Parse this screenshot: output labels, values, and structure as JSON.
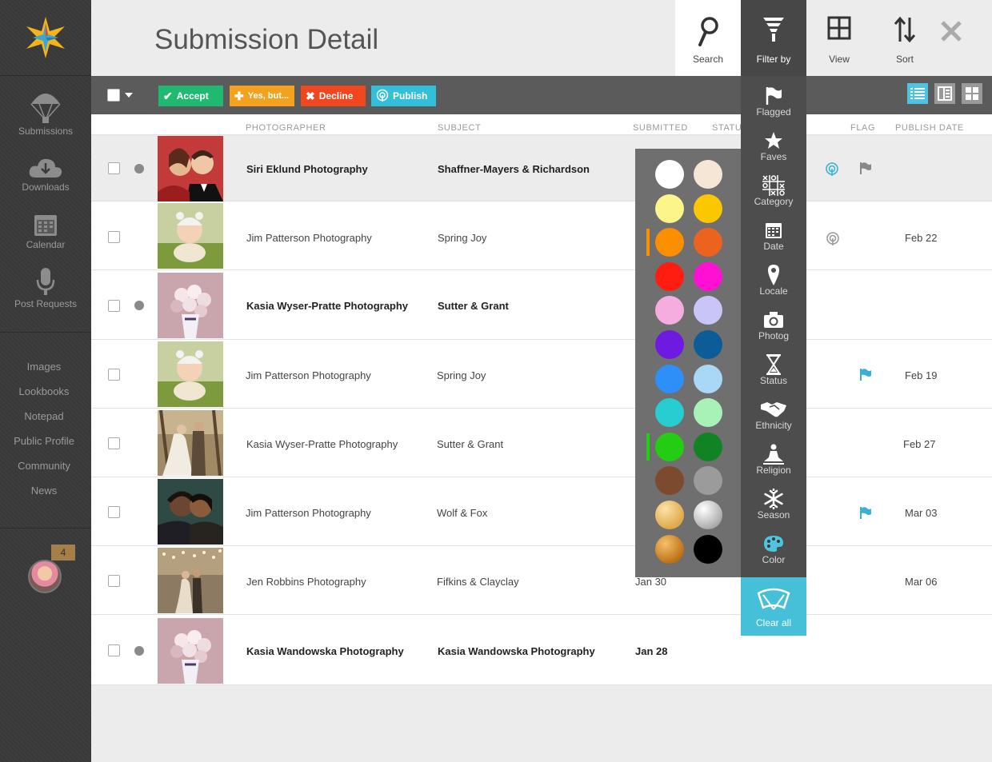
{
  "header": {
    "title": "Submission Detail"
  },
  "tools": {
    "search": "Search",
    "filter": "Filter by",
    "view": "View",
    "sort": "Sort"
  },
  "nav": {
    "main": [
      {
        "label": "Submissions",
        "icon": "parachute-icon"
      },
      {
        "label": "Downloads",
        "icon": "cloud-download-icon"
      },
      {
        "label": "Calendar",
        "icon": "calendar-icon"
      },
      {
        "label": "Post Requests",
        "icon": "microphone-icon"
      }
    ],
    "secondary": [
      "Images",
      "Lookbooks",
      "Notepad",
      "Public Profile",
      "Community",
      "News"
    ],
    "notifications": "4"
  },
  "toolbar": {
    "accept": "Accept",
    "yes_but": "Yes, but...",
    "decline": "Decline",
    "publish": "Publish"
  },
  "columns": {
    "photographer": "PHOTOGRAPHER",
    "subject": "SUBJECT",
    "submitted": "SUBMITTED",
    "status": "STATU",
    "flag": "FLAG",
    "publish_date": "PUBLISH DATE"
  },
  "rows": [
    {
      "photographer": "Siri Eklund Photography",
      "subject": "Shaffner-Mayers & Richardson",
      "submitted": "",
      "publish_date": "",
      "unread": true,
      "published": true,
      "flagged": true,
      "selected": true
    },
    {
      "photographer": "Jim Patterson Photography",
      "subject": "Spring Joy",
      "submitted": "",
      "publish_date": "Feb 22",
      "unread": false,
      "published": true,
      "flagged": false,
      "selected": false
    },
    {
      "photographer": "Kasia Wyser-Pratte Photography",
      "subject": "Sutter & Grant",
      "submitted": "",
      "publish_date": "",
      "unread": true,
      "published": false,
      "flagged": false,
      "selected": false
    },
    {
      "photographer": "Jim Patterson Photography",
      "subject": "Spring Joy",
      "submitted": "",
      "publish_date": "Feb 19",
      "unread": false,
      "published": false,
      "flagged": true,
      "selected": false
    },
    {
      "photographer": "Kasia Wyser-Pratte Photography",
      "subject": "Sutter & Grant",
      "submitted": "",
      "publish_date": "Feb 27",
      "unread": false,
      "published": false,
      "flagged": false,
      "selected": false
    },
    {
      "photographer": "Jim Patterson Photography",
      "subject": "Wolf & Fox",
      "submitted": "",
      "publish_date": "Mar 03",
      "unread": false,
      "published": false,
      "flagged": true,
      "selected": false
    },
    {
      "photographer": "Jen Robbins Photography",
      "subject": "Fifkins & Clayclay",
      "submitted": "Jan 30",
      "publish_date": "Mar 06",
      "unread": false,
      "published": false,
      "flagged": false,
      "selected": false
    },
    {
      "photographer": "Kasia Wandowska Photography",
      "subject": "Kasia Wandowska Photography",
      "submitted": "Jan 28",
      "publish_date": "",
      "unread": true,
      "published": false,
      "flagged": false,
      "selected": false
    }
  ],
  "filter_menu": [
    {
      "label": "Flagged",
      "icon": "flag-icon"
    },
    {
      "label": "Faves",
      "icon": "star-icon"
    },
    {
      "label": "Category",
      "icon": "tic-tac-toe-icon"
    },
    {
      "label": "Date",
      "icon": "calendar-icon"
    },
    {
      "label": "Locale",
      "icon": "map-pin-icon"
    },
    {
      "label": "Photog",
      "icon": "camera-icon"
    },
    {
      "label": "Status",
      "icon": "hourglass-icon"
    },
    {
      "label": "Ethnicity",
      "icon": "handshake-icon"
    },
    {
      "label": "Religion",
      "icon": "meditation-icon"
    },
    {
      "label": "Season",
      "icon": "snowflake-icon"
    },
    {
      "label": "Color",
      "icon": "palette-icon"
    }
  ],
  "clear_all": "Clear all",
  "palette": {
    "colors": [
      "#ffffff",
      "#f6e6d6",
      "#fbf58a",
      "#fbc800",
      "#fb8f00",
      "#ec6320",
      "#ff1c10",
      "#ff10d3",
      "#f5acdf",
      "#c9c5f7",
      "#6f1ae0",
      "#0b5c97",
      "#2d8ff7",
      "#a8d8f6",
      "#28cdd2",
      "#a8f1b7",
      "#23cd14",
      "#128325",
      "#7b4a2f",
      "#9b9b9b",
      "gold-gradient",
      "silver-gradient",
      "bronze-gradient",
      "#000000"
    ],
    "selected": [
      "#fb8f00",
      "#23cd14"
    ]
  },
  "accent": {
    "filter_bg": "#474747",
    "clear_all": "#46bfd8",
    "accept": "#1fba6f",
    "yes_but": "#f4a11d",
    "decline": "#f1471f",
    "publish": "#33bfd9"
  }
}
